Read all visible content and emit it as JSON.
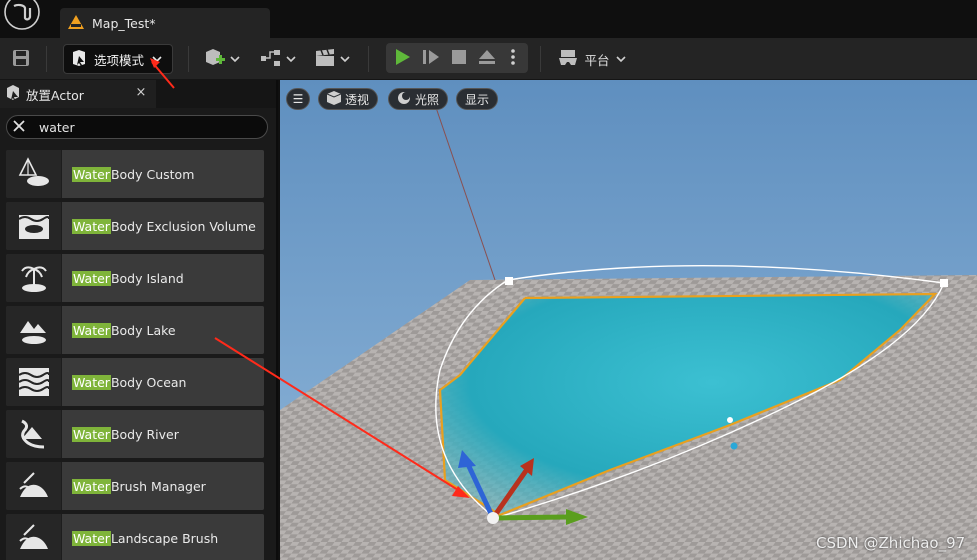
{
  "window": {
    "tab_title": "Map_Test*"
  },
  "toolbar": {
    "mode_label": "选项模式",
    "platform_label": "平台",
    "icons": [
      "save-icon",
      "mode-icon",
      "add-actor-icon",
      "blueprint-icon",
      "cinematics-icon",
      "play-icon",
      "step-icon",
      "stop-icon",
      "eject-icon",
      "more-icon",
      "platform-icon"
    ],
    "play_color": "#5fb83a"
  },
  "panel": {
    "title": "放置Actor",
    "close_label": "×",
    "search_value": "water",
    "highlight_color": "#7fb43a",
    "items": [
      {
        "match": "Water",
        "rest": " Body Custom",
        "icon": "water-body-custom-icon"
      },
      {
        "match": "Water",
        "rest": " Body Exclusion Volume",
        "icon": "water-exclusion-volume-icon"
      },
      {
        "match": "Water",
        "rest": " Body Island",
        "icon": "water-island-icon"
      },
      {
        "match": "Water",
        "rest": " Body Lake",
        "icon": "water-lake-icon"
      },
      {
        "match": "Water",
        "rest": " Body Ocean",
        "icon": "water-ocean-icon"
      },
      {
        "match": "Water",
        "rest": " Body River",
        "icon": "water-river-icon"
      },
      {
        "match": "Water",
        "rest": " Brush Manager",
        "icon": "water-brush-manager-icon"
      },
      {
        "match": "Water",
        "rest": " Landscape Brush",
        "icon": "water-landscape-brush-icon"
      }
    ]
  },
  "viewport": {
    "menu_label": "☰",
    "perspective_label": "透视",
    "lighting_label": "光照",
    "show_label": "显示",
    "sky_color": "#6f9fcc",
    "water_color": "#2ab2c6",
    "spline_outline_color": "#e8a020",
    "annotation_arrow_color": "#ff2a1a"
  },
  "watermark": "CSDN @Zhichao_97"
}
